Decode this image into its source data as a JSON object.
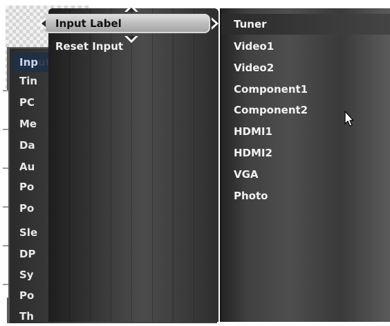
{
  "main_menu": {
    "items": [
      {
        "label": "Inp",
        "ghost": "ut Label"
      },
      {
        "label": "Tin",
        "ghost": ""
      },
      {
        "label": "PC",
        "ghost": ""
      },
      {
        "label": "Me",
        "ghost": ""
      },
      {
        "label": "Da",
        "ghost": ""
      },
      {
        "label": "Au",
        "ghost": ""
      },
      {
        "label": "Po",
        "ghost": ""
      },
      {
        "label": "Po",
        "ghost": ""
      },
      {
        "label": "Sle",
        "ghost": ""
      },
      {
        "label": "DP",
        "ghost": ""
      },
      {
        "label": "Sy",
        "ghost": ""
      },
      {
        "label": "Po",
        "ghost": ""
      },
      {
        "label": "Th",
        "ghost": ""
      }
    ]
  },
  "submenu": {
    "items": [
      {
        "label": "Input Label",
        "selected": true
      },
      {
        "label": "Reset Input",
        "selected": false
      }
    ]
  },
  "options": {
    "items": [
      {
        "label": "Tuner",
        "highlighted": true
      },
      {
        "label": "Video1",
        "highlighted": false
      },
      {
        "label": "Video2",
        "highlighted": false
      },
      {
        "label": "Component1",
        "highlighted": false
      },
      {
        "label": "Component2",
        "highlighted": false
      },
      {
        "label": "HDMI1",
        "highlighted": false
      },
      {
        "label": "HDMI2",
        "highlighted": false
      },
      {
        "label": "VGA",
        "highlighted": false
      },
      {
        "label": "Photo",
        "highlighted": false
      }
    ]
  },
  "icons": {
    "up": "chevron-up-icon",
    "down": "chevron-down-icon",
    "left": "chevron-left-icon",
    "right": "chevron-right-icon",
    "cursor": "mouse-pointer-icon"
  },
  "colors": {
    "selection_blue": "#1e2f46",
    "highlight_bar": "#bcbcbc",
    "text_light": "#f2f2f2"
  }
}
